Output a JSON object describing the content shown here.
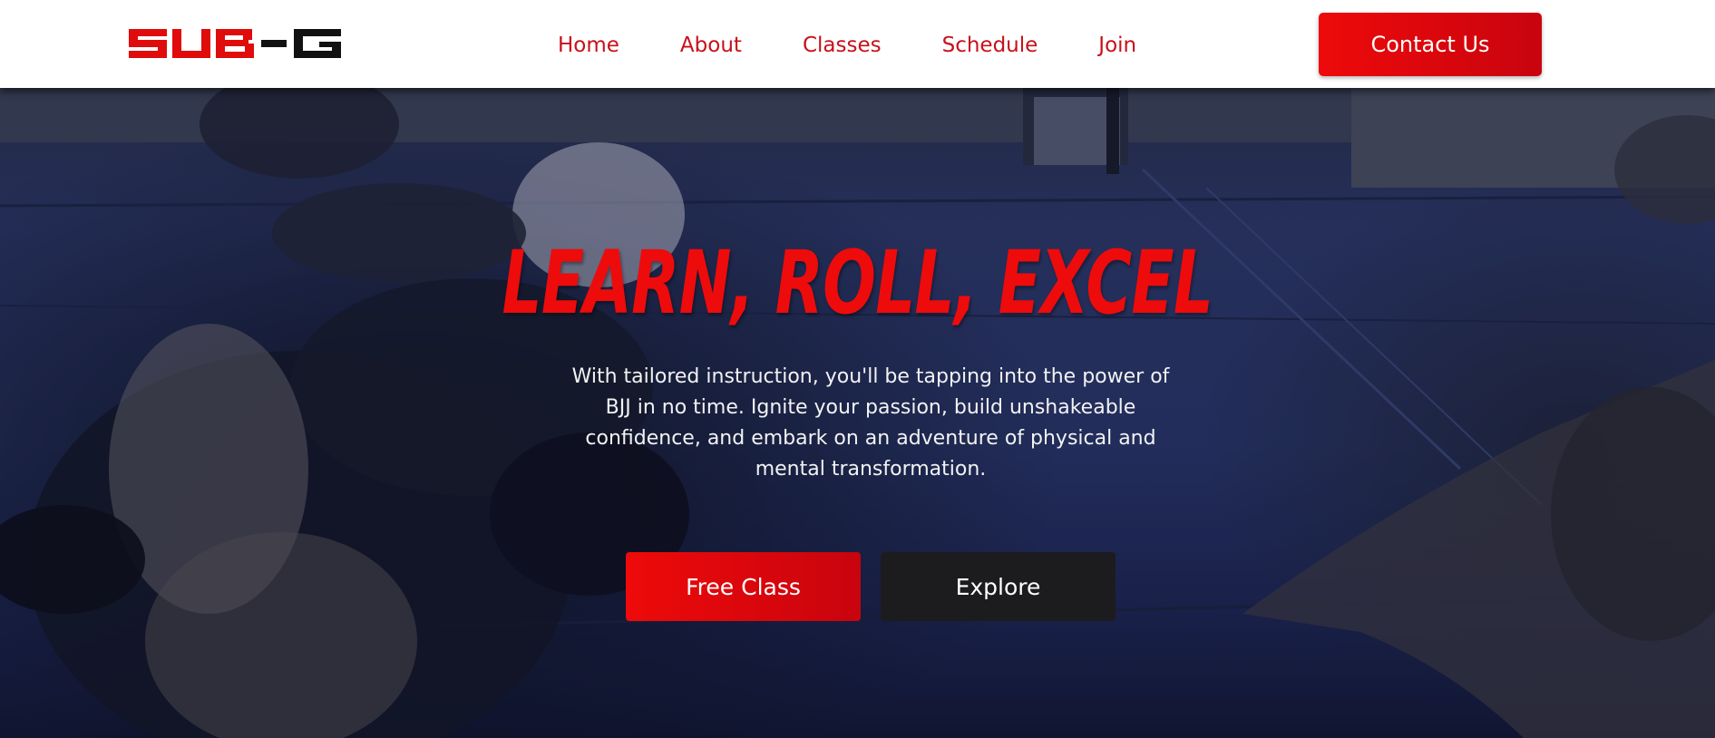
{
  "header": {
    "logo_text": "SUB-G",
    "nav": [
      {
        "label": "Home"
      },
      {
        "label": "About"
      },
      {
        "label": "Classes"
      },
      {
        "label": "Schedule"
      },
      {
        "label": "Join"
      }
    ],
    "contact_label": "Contact Us"
  },
  "hero": {
    "title": "LEARN, ROLL, EXCEL",
    "text": "With tailored instruction, you'll be tapping into the power of BJJ in no time. Ignite your passion, build unshakeable confidence, and embark on an adventure of physical and mental transformation.",
    "primary_button": "Free Class",
    "secondary_button": "Explore"
  },
  "colors": {
    "brand_red": "#ee0a0a",
    "nav_red": "#c8101a",
    "dark_button": "#1c1c1f",
    "mat_blue": "#2c3768"
  }
}
